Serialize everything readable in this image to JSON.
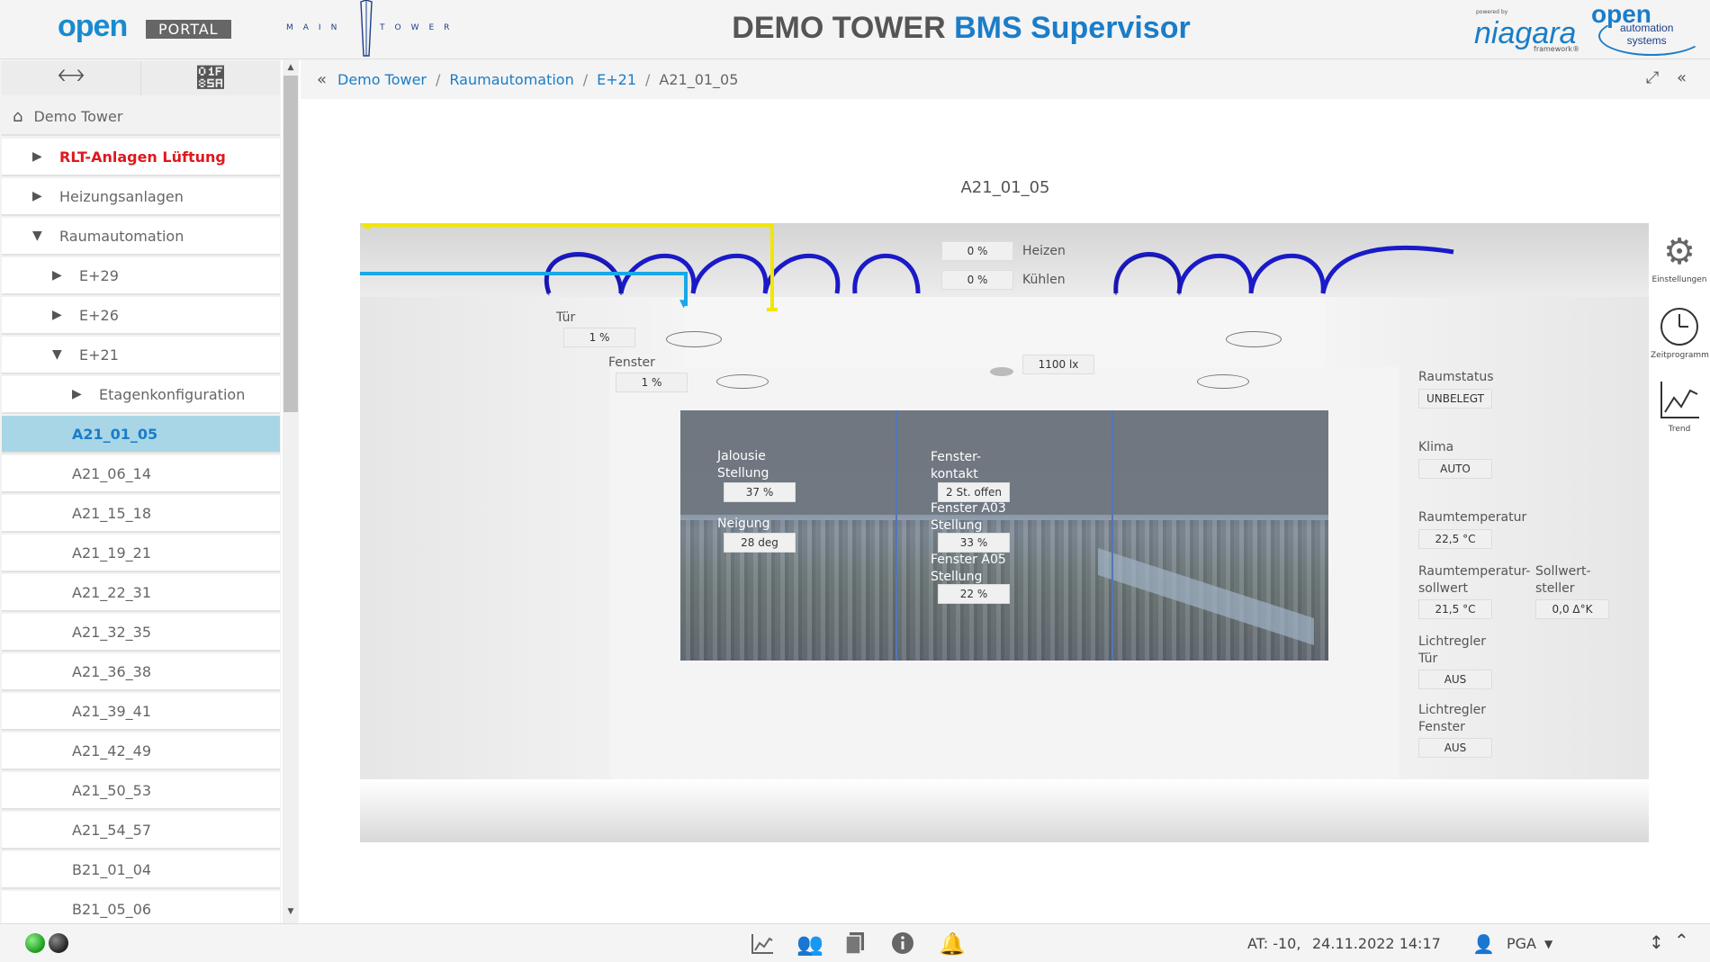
{
  "header": {
    "logo_open": "open",
    "logo_portal": "PORTAL",
    "logo_main": "MAIN",
    "logo_tower": "TOWER",
    "title_prefix": "DEMO TOWER ",
    "title_accent": "BMS Supervisor",
    "niagara_powered": "powered by",
    "niagara": "niagara",
    "niagara_fw": "framework®",
    "oas_open": "open",
    "oas_sub1": "automation",
    "oas_sub2": "systems"
  },
  "sidebar": {
    "back_icon": "arrow-left-icon",
    "forward_icon": "arrow-right-icon",
    "items": [
      {
        "label": "Demo Tower"
      },
      {
        "label": "RLT-Anlagen Lüftung"
      },
      {
        "label": "Heizungsanlagen"
      },
      {
        "label": "Raumautomation"
      },
      {
        "label": "E+29"
      },
      {
        "label": "E+26"
      },
      {
        "label": "E+21"
      },
      {
        "label": "Etagenkonfiguration"
      },
      {
        "label": "A21_01_05"
      },
      {
        "label": "A21_06_14"
      },
      {
        "label": "A21_15_18"
      },
      {
        "label": "A21_19_21"
      },
      {
        "label": "A21_22_31"
      },
      {
        "label": "A21_32_35"
      },
      {
        "label": "A21_36_38"
      },
      {
        "label": "A21_39_41"
      },
      {
        "label": "A21_42_49"
      },
      {
        "label": "A21_50_53"
      },
      {
        "label": "A21_54_57"
      },
      {
        "label": "B21_01_04"
      },
      {
        "label": "B21_05_06"
      }
    ]
  },
  "breadcrumb": {
    "items": [
      "Demo Tower",
      "Raumautomation",
      "E+21",
      "A21_01_05"
    ]
  },
  "room": {
    "title": "A21_01_05",
    "heizen_label": "Heizen",
    "heizen_value": "0 %",
    "kuehlen_label": "Kühlen",
    "kuehlen_value": "0 %",
    "tuer_label": "Tür",
    "tuer_value": "1 %",
    "fenster_label": "Fenster",
    "fenster_value": "1 %",
    "lux_value": "1100 lx",
    "jalousie_label1": "Jalousie",
    "jalousie_label2": "Stellung",
    "jalousie_value": "37 %",
    "neigung_label": "Neigung",
    "neigung_value": "28 deg",
    "fensterkontakt_label1": "Fenster-",
    "fensterkontakt_label2": "kontakt",
    "fensterkontakt_value": "2 St. offen",
    "fa03_label1": "Fenster A03",
    "fa03_label2": "Stellung",
    "fa03_value": "33 %",
    "fa05_label1": "Fenster A05",
    "fa05_label2": "Stellung",
    "fa05_value": "22 %",
    "raumstatus_label": "Raumstatus",
    "raumstatus_value": "UNBELEGT",
    "klima_label": "Klima",
    "klima_value": "AUTO",
    "raumtemp_label": "Raumtemperatur",
    "raumtemp_value": "22,5 °C",
    "raumtemp_soll_label1": "Raumtemperatur-",
    "raumtemp_soll_label2": "sollwert",
    "raumtemp_soll_value": "21,5 °C",
    "sollwertsteller_label1": "Sollwert-",
    "sollwertsteller_label2": "steller",
    "sollwertsteller_value": "0,0 Δ°K",
    "lichtregler_tuer_label1": "Lichtregler",
    "lichtregler_tuer_label2": "Tür",
    "lichtregler_tuer_value": "AUS",
    "lichtregler_fenster_label1": "Lichtregler",
    "lichtregler_fenster_label2": "Fenster",
    "lichtregler_fenster_value": "AUS"
  },
  "tools": [
    {
      "label": "Einstellungen",
      "icon": "gear-icon"
    },
    {
      "label": "Zeitprogramm",
      "icon": "clock-icon"
    },
    {
      "label": "Trend",
      "icon": "trend-chart-icon"
    }
  ],
  "footer": {
    "at": "AT: -10,",
    "datetime": "24.11.2022 14:17",
    "user": "PGA"
  },
  "colors": {
    "accent": "#1a7dc8",
    "selected_bg": "#a9d6e6",
    "alarm_red": "#e0181e",
    "heating_pipe": "#1a1ac8",
    "supply_yellow": "#f2e600",
    "supply_blue": "#18a8e8"
  }
}
